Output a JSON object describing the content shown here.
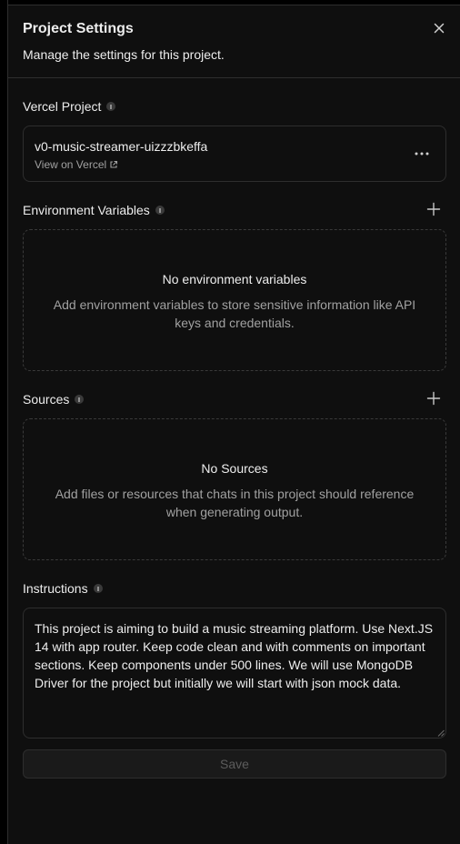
{
  "header": {
    "title": "Project Settings",
    "subtitle": "Manage the settings for this project.",
    "close_icon": "close-icon"
  },
  "vercel_project": {
    "label": "Vercel Project",
    "name": "v0-music-streamer-uizzzbkeffa",
    "view_link": "View on Vercel",
    "more_icon": "more-horizontal-icon"
  },
  "env_vars": {
    "label": "Environment Variables",
    "empty_title": "No environment variables",
    "empty_desc": "Add environment variables to store sensitive information like API keys and credentials."
  },
  "sources": {
    "label": "Sources",
    "empty_title": "No Sources",
    "empty_desc": "Add files or resources that chats in this project should reference when generating output."
  },
  "instructions": {
    "label": "Instructions",
    "value": "This project is aiming to build a music streaming platform. Use Next.JS 14 with app router. Keep code clean and with comments on important sections. Keep components under 500 lines. We will use MongoDB Driver for the project but initially we will start with json mock data."
  },
  "save_label": "Save",
  "colors": {
    "background": "#0f0f0f",
    "border": "#2e2e2e",
    "text": "#ededed",
    "muted": "#a1a1a1"
  }
}
